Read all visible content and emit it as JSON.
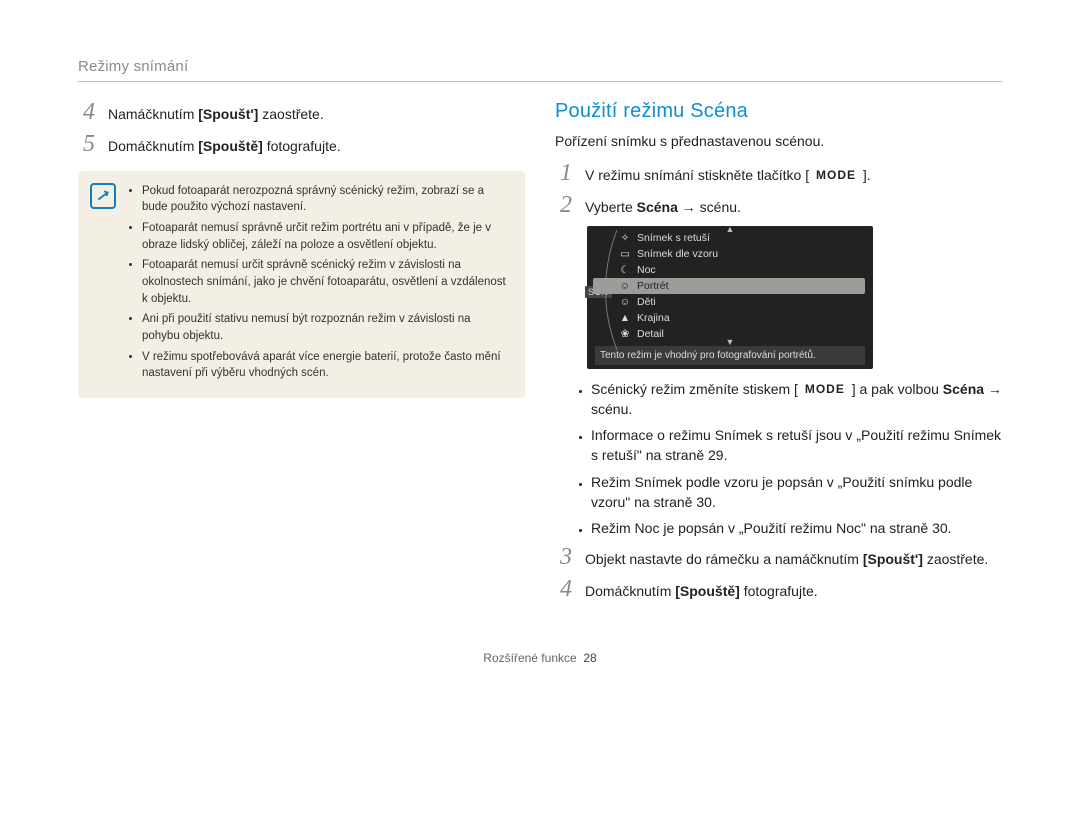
{
  "header": "Režimy snímání",
  "left": {
    "step4_num": "4",
    "step4_a": "Namáčknutím ",
    "step4_bold": "[Spoušt']",
    "step4_b": " zaostřete.",
    "step5_num": "5",
    "step5_a": "Domáčknutím ",
    "step5_bold": "[Spouště]",
    "step5_b": " fotografujte.",
    "notes": [
      "Pokud fotoaparát nerozpozná správný scénický režim, zobrazí se a bude použito výchozí nastavení.",
      "Fotoaparát nemusí správně určit režim portrétu ani v případě, že je v obraze lidský obličej, záleží na poloze a osvětlení objektu.",
      "Fotoaparát nemusí určit správně scénický režim v závislosti na okolnostech snímání, jako je chvění fotoaparátu, osvětlení a vzdálenost k objektu.",
      "Ani při použití stativu nemusí být rozpoznán režim  v závislosti na pohybu objektu.",
      "V režimu  spotřebovává aparát více energie baterií, protože často mění nastavení při výběru vhodných scén."
    ]
  },
  "right": {
    "title": "Použití režimu Scéna",
    "desc": "Pořízení snímku s přednastavenou scénou.",
    "step1_num": "1",
    "step1_a": "V režimu snímání stiskněte tlačítko [",
    "step1_mode": "MODE",
    "step1_b": "].",
    "step2_num": "2",
    "step2_a": "Vyberte ",
    "step2_bold": "Scéna",
    "step2_b": " → scénu.",
    "screen_items": [
      {
        "icon": "✧",
        "label": "Snímek s retuší",
        "sel": false
      },
      {
        "icon": "▭",
        "label": "Snímek dle vzoru",
        "sel": false
      },
      {
        "icon": "☾",
        "label": "Noc",
        "sel": false
      },
      {
        "icon": "☺",
        "label": "Portrét",
        "sel": true
      },
      {
        "icon": "☺",
        "label": "Děti",
        "sel": false
      },
      {
        "icon": "▲",
        "label": "Krajina",
        "sel": false
      },
      {
        "icon": "❀",
        "label": "Detail",
        "sel": false
      }
    ],
    "screen_badge": "SCN",
    "screen_caption": "Tento režim je vhodný pro fotografování portrétů.",
    "bullets": [
      {
        "pre": "Scénický režim změníte stiskem [",
        "chip": "MODE",
        "mid": "] a pak volbou ",
        "bold": "Scéna",
        "post": " → scénu."
      },
      {
        "pre": "Informace o režimu Snímek s retuší jsou v „Použití režimu Snímek s retuší\" na straně 29.",
        "chip": "",
        "mid": "",
        "bold": "",
        "post": ""
      },
      {
        "pre": "Režim Snímek podle vzoru je popsán v „Použití snímku podle vzoru\" na straně 30.",
        "chip": "",
        "mid": "",
        "bold": "",
        "post": ""
      },
      {
        "pre": "Režim Noc je popsán v „Použití režimu Noc\" na straně 30.",
        "chip": "",
        "mid": "",
        "bold": "",
        "post": ""
      }
    ],
    "step3_num": "3",
    "step3_a": "Objekt nastavte do rámečku a namáčknutím ",
    "step3_bold": "[Spoušt']",
    "step3_b": " zaostřete.",
    "step4_num": "4",
    "step4_a": "Domáčknutím ",
    "step4_bold": "[Spouště]",
    "step4_b": " fotografujte."
  },
  "footer": {
    "section": "Rozšířené funkce",
    "page": "28"
  }
}
